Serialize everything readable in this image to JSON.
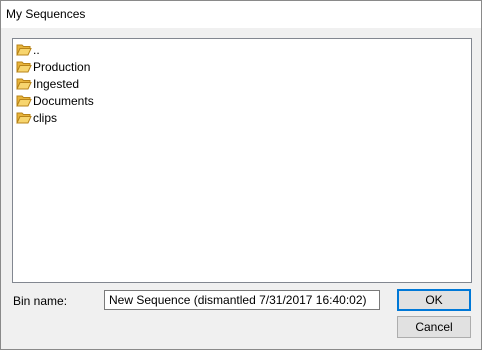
{
  "window": {
    "title": "My Sequences"
  },
  "file_list": {
    "items": [
      {
        "label": "..",
        "icon": "folder-open-icon"
      },
      {
        "label": "Production",
        "icon": "folder-open-icon"
      },
      {
        "label": "Ingested",
        "icon": "folder-open-icon"
      },
      {
        "label": "Documents",
        "icon": "folder-open-icon"
      },
      {
        "label": "clips",
        "icon": "folder-open-icon"
      }
    ]
  },
  "bin": {
    "label": "Bin name:",
    "value": "New Sequence (dismantled 7/31/2017 16:40:02)"
  },
  "buttons": {
    "ok": "OK",
    "cancel": "Cancel"
  },
  "colors": {
    "folder": "#f2c14e",
    "folder_dark": "#c9961f",
    "accent": "#0078d7"
  }
}
